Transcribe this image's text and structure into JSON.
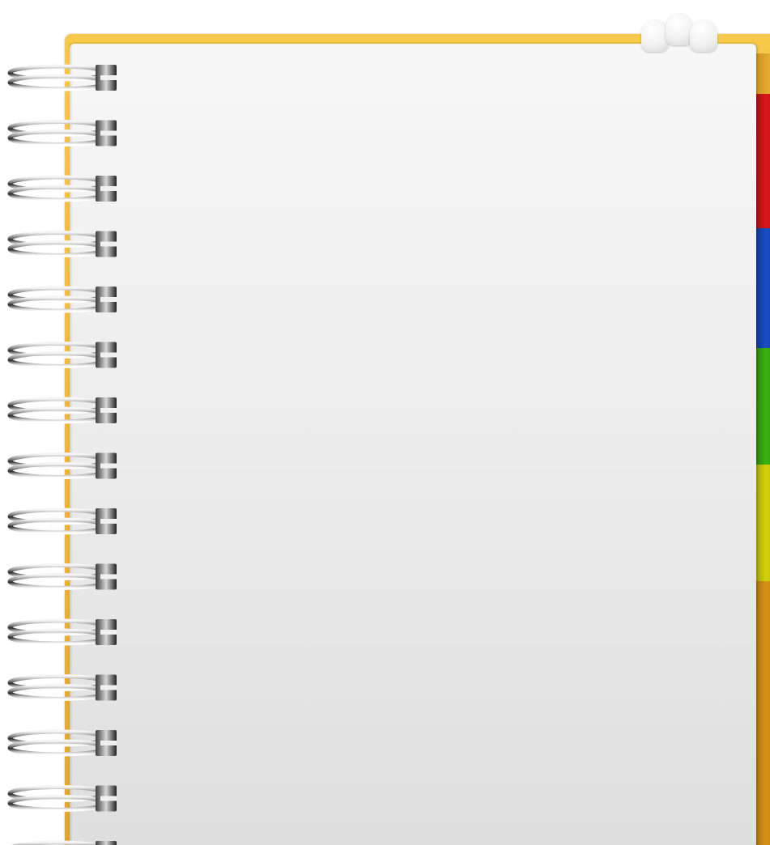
{
  "scene": {
    "subject": "spiral notebook",
    "colors": {
      "cover": "#f3bb3a",
      "page": "#ececec",
      "tab_red": "#d8171b",
      "tab_blue": "#1a4fc8",
      "tab_green": "#3cb40f",
      "tab_lime": "#d3d10c",
      "tab_orange": "#d79317",
      "ring_metal": "#9a9a9a"
    },
    "ring_count": 15,
    "tab_count": 5
  }
}
